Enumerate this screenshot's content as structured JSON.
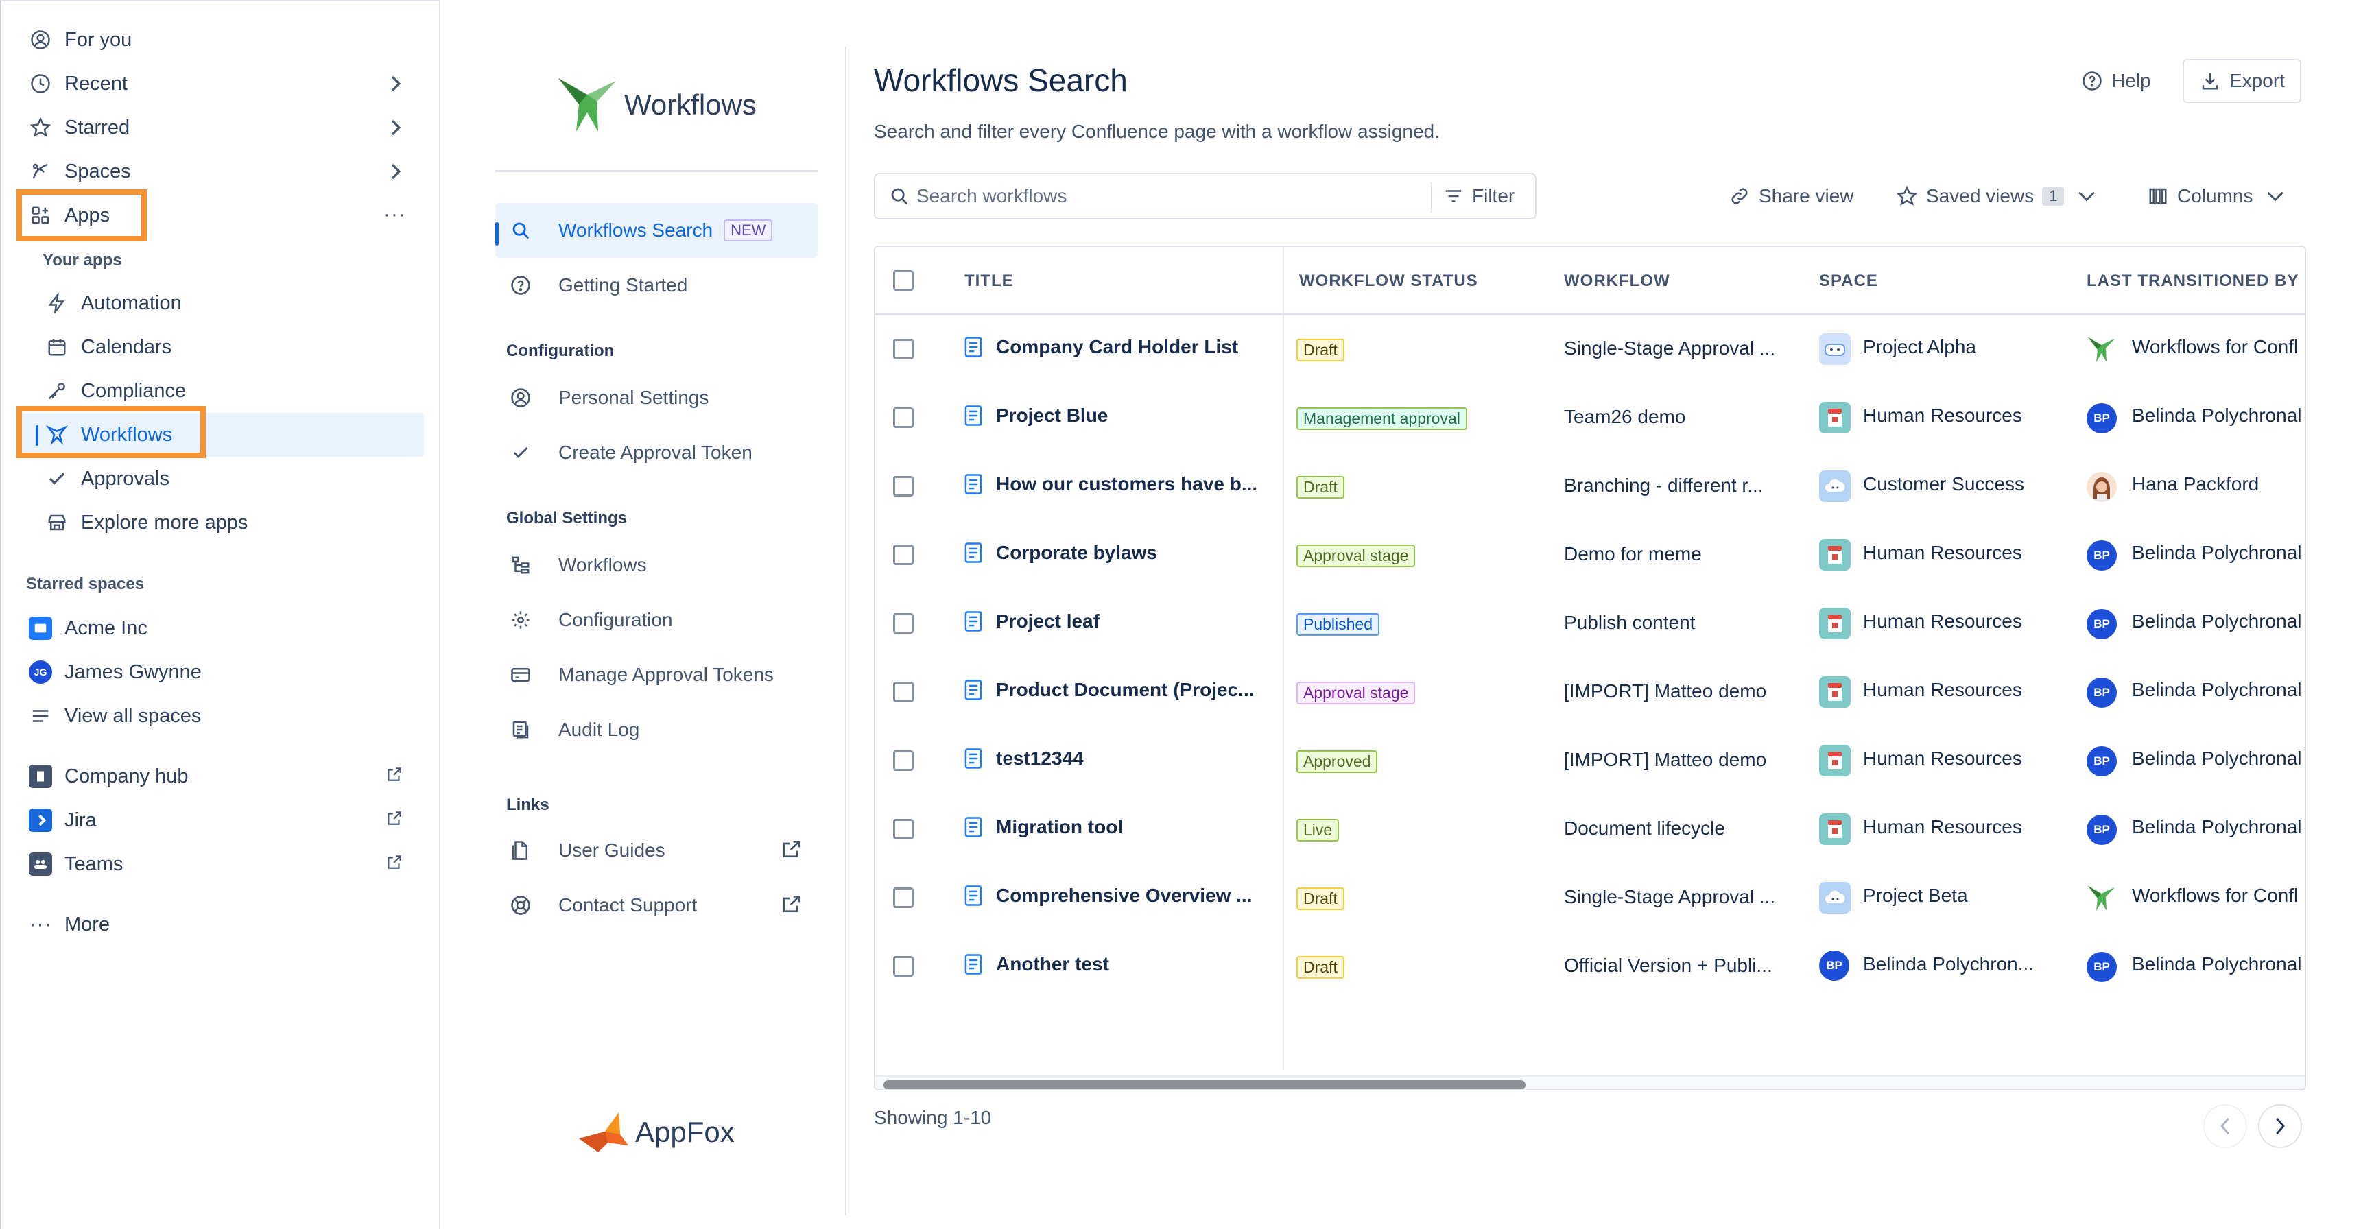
{
  "leftnav": {
    "top_items": [
      {
        "label": "For you"
      },
      {
        "label": "Recent"
      },
      {
        "label": "Starred"
      },
      {
        "label": "Spaces"
      },
      {
        "label": "Apps"
      }
    ],
    "your_apps_heading": "Your apps",
    "apps": [
      {
        "label": "Automation"
      },
      {
        "label": "Calendars"
      },
      {
        "label": "Compliance"
      },
      {
        "label": "Workflows"
      },
      {
        "label": "Approvals"
      },
      {
        "label": "Explore more apps"
      }
    ],
    "starred_heading": "Starred spaces",
    "starred": [
      {
        "label": "Acme Inc"
      },
      {
        "label": "James Gwynne",
        "initials": "JG"
      },
      {
        "label": "View all spaces"
      }
    ],
    "external": [
      {
        "label": "Company hub"
      },
      {
        "label": "Jira"
      },
      {
        "label": "Teams"
      }
    ],
    "more_label": "More",
    "more_dots": "···",
    "highlight_color": "#f79232"
  },
  "midpanel": {
    "logo_text": "Workflows",
    "items_top": [
      {
        "label": "Workflows Search",
        "badge": "NEW"
      },
      {
        "label": "Getting Started"
      }
    ],
    "config_heading": "Configuration",
    "config_items": [
      {
        "label": "Personal Settings"
      },
      {
        "label": "Create Approval Token"
      }
    ],
    "global_heading": "Global Settings",
    "global_items": [
      {
        "label": "Workflows"
      },
      {
        "label": "Configuration"
      },
      {
        "label": "Manage Approval Tokens"
      },
      {
        "label": "Audit Log"
      }
    ],
    "links_heading": "Links",
    "links_items": [
      {
        "label": "User Guides"
      },
      {
        "label": "Contact Support"
      }
    ],
    "footer_logo_text": "AppFox"
  },
  "main": {
    "title": "Workflows Search",
    "description": "Search and filter every Confluence page with a workflow assigned.",
    "help_label": "Help",
    "export_label": "Export",
    "search_placeholder": "Search workflows",
    "filter_label": "Filter",
    "share_label": "Share view",
    "saved_views_label": "Saved views",
    "saved_views_count": "1",
    "columns_label": "Columns",
    "columns": [
      "TITLE",
      "WORKFLOW STATUS",
      "WORKFLOW",
      "SPACE",
      "LAST TRANSITIONED BY"
    ],
    "rows": [
      {
        "title": "Company Card Holder List",
        "status": "Draft",
        "status_kind": "draft",
        "workflow": "Single-Stage Approval ...",
        "space": "Project Alpha",
        "space_icon": "alpha",
        "user": "Workflows for Confl",
        "user_icon": "workflows"
      },
      {
        "title": "Project Blue",
        "status": "Management approval",
        "status_kind": "mgmt",
        "workflow": "Team26 demo",
        "space": "Human Resources",
        "space_icon": "hr",
        "user": "Belinda Polychronal",
        "user_icon": "bp",
        "user_initials": "BP"
      },
      {
        "title": "How our customers have b...",
        "status": "Draft",
        "status_kind": "draft-green",
        "workflow": "Branching - different r...",
        "space": "Customer Success",
        "space_icon": "cloud",
        "user": "Hana Packford",
        "user_icon": "hana"
      },
      {
        "title": "Corporate bylaws",
        "status": "Approval stage",
        "status_kind": "approval",
        "workflow": "Demo for meme",
        "space": "Human Resources",
        "space_icon": "hr",
        "user": "Belinda Polychronal",
        "user_icon": "bp",
        "user_initials": "BP"
      },
      {
        "title": "Project leaf",
        "status": "Published",
        "status_kind": "published",
        "workflow": "Publish content",
        "space": "Human Resources",
        "space_icon": "hr",
        "user": "Belinda Polychronal",
        "user_icon": "bp",
        "user_initials": "BP"
      },
      {
        "title": "Product Document (Projec...",
        "status": "Approval stage",
        "status_kind": "approval-purple",
        "workflow": "[IMPORT] Matteo demo",
        "space": "Human Resources",
        "space_icon": "hr",
        "user": "Belinda Polychronal",
        "user_icon": "bp",
        "user_initials": "BP"
      },
      {
        "title": "test12344",
        "status": "Approved",
        "status_kind": "approved",
        "workflow": "[IMPORT] Matteo demo",
        "space": "Human Resources",
        "space_icon": "hr",
        "user": "Belinda Polychronal",
        "user_icon": "bp",
        "user_initials": "BP"
      },
      {
        "title": "Migration tool",
        "status": "Live",
        "status_kind": "live",
        "workflow": "Document lifecycle",
        "space": "Human Resources",
        "space_icon": "hr",
        "user": "Belinda Polychronal",
        "user_icon": "bp",
        "user_initials": "BP"
      },
      {
        "title": "Comprehensive Overview ...",
        "status": "Draft",
        "status_kind": "draft",
        "workflow": "Single-Stage Approval ...",
        "space": "Project Beta",
        "space_icon": "cloud",
        "user": "Workflows for Confl",
        "user_icon": "workflows"
      },
      {
        "title": "Another test",
        "status": "Draft",
        "status_kind": "draft",
        "workflow": "Official Version + Publi...",
        "space": "Belinda Polychron...",
        "space_icon": "bp",
        "space_initials": "BP",
        "user": "Belinda Polychronal",
        "user_icon": "bp",
        "user_initials": "BP"
      }
    ],
    "showing_label": "Showing 1-10"
  }
}
